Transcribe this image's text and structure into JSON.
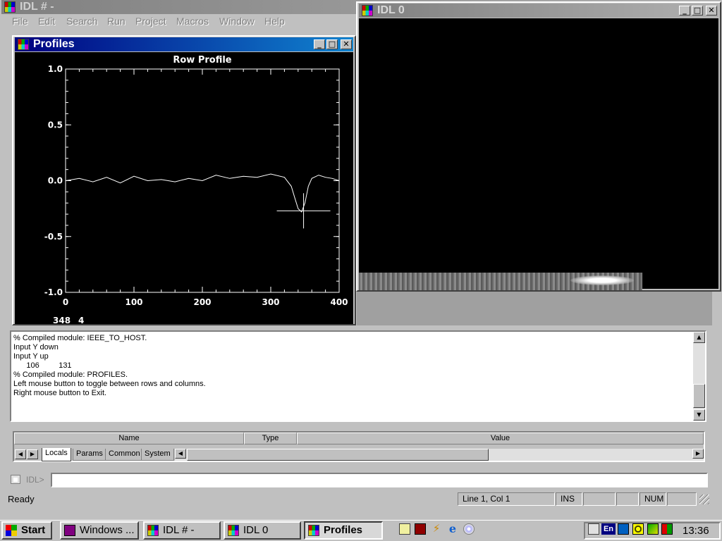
{
  "main_window": {
    "title": "IDL # -",
    "menu": [
      "File",
      "Edit",
      "Search",
      "Run",
      "Project",
      "Macros",
      "Window",
      "Help"
    ]
  },
  "profiles_window": {
    "title": "Profiles",
    "cursor_readout_x": "348",
    "cursor_readout_y": "4"
  },
  "idl0_window": {
    "title": "IDL 0"
  },
  "chart_data": {
    "type": "line",
    "title": "Row Profile",
    "xlabel": "",
    "ylabel": "",
    "xlim": [
      0,
      400
    ],
    "ylim": [
      -1.0,
      1.0
    ],
    "x_ticks": [
      "0",
      "100",
      "200",
      "300",
      "400"
    ],
    "y_ticks": [
      "1.0",
      "0.5",
      "0.0",
      "-0.5",
      "-1.0"
    ],
    "series": [
      {
        "x": [
          0,
          20,
          40,
          60,
          80,
          100,
          120,
          140,
          160,
          180,
          200,
          220,
          240,
          260,
          280,
          300,
          320,
          330,
          335,
          340,
          345,
          350,
          355,
          360,
          370,
          380,
          390,
          400
        ],
        "values": [
          0.0,
          0.02,
          -0.01,
          0.03,
          -0.02,
          0.04,
          0.0,
          0.01,
          -0.01,
          0.02,
          0.0,
          0.05,
          0.02,
          0.04,
          0.03,
          0.06,
          0.03,
          -0.05,
          -0.15,
          -0.25,
          -0.28,
          -0.2,
          -0.05,
          0.02,
          0.05,
          0.03,
          0.02,
          0.0
        ]
      }
    ],
    "crosshair": {
      "x": 348,
      "y": -0.27
    }
  },
  "console": {
    "lines": [
      "% Compiled module: IEEE_TO_HOST.",
      "Input Y down",
      "Input Y up",
      "      106         131",
      "% Compiled module: PROFILES.",
      "Left mouse button to toggle between rows and columns.",
      "Right mouse button to Exit."
    ]
  },
  "variables": {
    "columns": [
      "Name",
      "Type",
      "Value"
    ],
    "tabs": [
      "Locals",
      "Params",
      "Common",
      "System"
    ]
  },
  "command": {
    "prompt": "IDL>",
    "value": ""
  },
  "status": {
    "message": "Ready",
    "position": "Line 1, Col 1",
    "ins": "INS",
    "num": "NUM"
  },
  "taskbar": {
    "start": "Start",
    "buttons": [
      "Windows ...",
      "IDL # -",
      "IDL 0",
      "Profiles"
    ],
    "tray_lang": "En",
    "clock": "13:36"
  }
}
